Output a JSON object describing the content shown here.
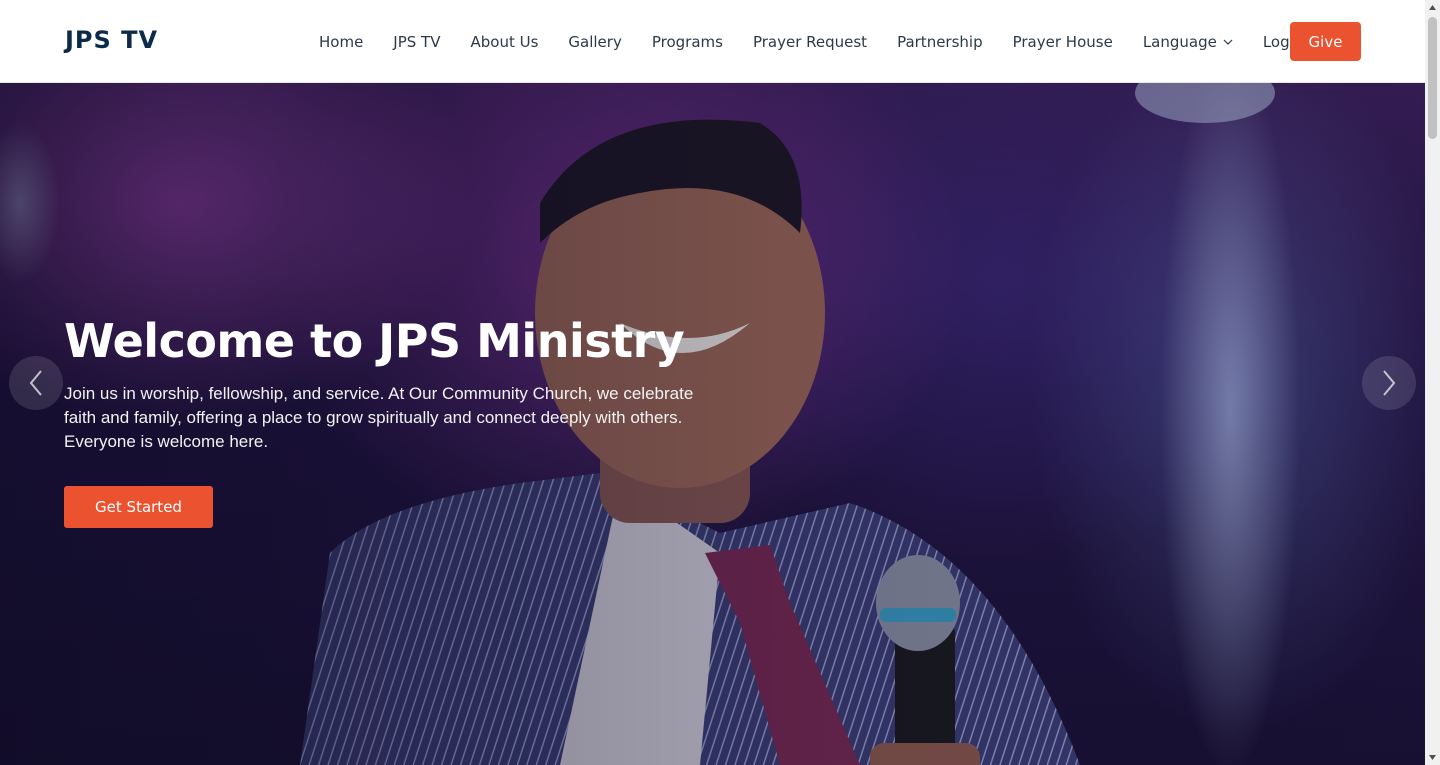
{
  "header": {
    "logo": "JPS TV",
    "nav": [
      {
        "label": "Home"
      },
      {
        "label": "JPS TV"
      },
      {
        "label": "About Us"
      },
      {
        "label": "Gallery"
      },
      {
        "label": "Programs"
      },
      {
        "label": "Prayer Request"
      },
      {
        "label": "Partnership"
      },
      {
        "label": "Prayer House"
      },
      {
        "label": "Language",
        "icon": "chevron-down-icon"
      },
      {
        "label": "Login"
      }
    ],
    "give_label": "Give"
  },
  "hero": {
    "title": "Welcome to JPS Ministry",
    "text": "Join us in worship, fellowship, and service. At Our Community Church, we celebrate faith and family, offering a place to grow spiritually and connect deeply with others. Everyone is welcome here.",
    "cta_label": "Get Started",
    "prev_icon": "chevron-left-icon",
    "next_icon": "chevron-right-icon"
  },
  "colors": {
    "accent": "#eb5230",
    "logo": "#0d2a4a",
    "nav_text": "#2b3a4a"
  }
}
